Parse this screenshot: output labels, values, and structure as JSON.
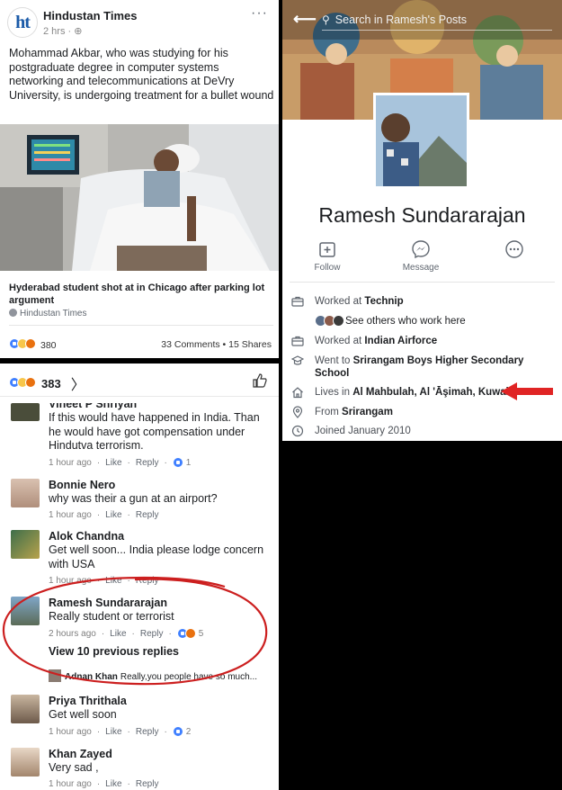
{
  "post": {
    "publisher": "Hindustan Times",
    "logo_text": "ht",
    "time": "2 hrs · ",
    "more": "···",
    "text": "Mohammad Akbar, who was studying for his postgraduate degree in computer systems networking and telecommunications at DeVry University, is undergoing treatment for a bullet wound",
    "link_title": "Hyderabad student shot at in Chicago after parking lot argument",
    "link_source": "Hindustan Times",
    "reaction_count": "380",
    "stats": "33 Comments • 15 Shares"
  },
  "comments_panel": {
    "reaction_count": "383",
    "chevron": "〉",
    "comments": [
      {
        "name": "Vineet P Shriyan",
        "text": "If this would have happened in India. Than he would have got compensation under Hindutva terrorism.",
        "time": "1 hour ago",
        "like": "Like",
        "reply": "Reply",
        "count": "1"
      },
      {
        "name": "Bonnie Nero",
        "text": "why  was their a gun at an airport?",
        "time": "1 hour ago",
        "like": "Like",
        "reply": "Reply"
      },
      {
        "name": "Alok Chandna",
        "text": "Get well soon... India please lodge concern with USA",
        "time": "1 hour ago",
        "like": "Like",
        "reply": "Reply"
      },
      {
        "name": "Ramesh Sundararajan",
        "text": "Really student or terrorist",
        "time": "2 hours ago",
        "like": "Like",
        "reply": "Reply",
        "count": "5"
      },
      {
        "name": "Priya Thrithala",
        "text": "Get well  soon",
        "time": "1 hour ago",
        "like": "Like",
        "reply": "Reply",
        "count": "2"
      },
      {
        "name": "Khan Zayed",
        "text": "Very sad ,",
        "time": "1 hour ago",
        "like": "Like",
        "reply": "Reply"
      }
    ],
    "view_replies": "View 10 previous replies",
    "reply": {
      "name": "Adnan Khan",
      "text": "Really,you people have so much..."
    }
  },
  "profile": {
    "search_placeholder": "Search in Ramesh's Posts",
    "name": "Ramesh Sundararajan",
    "actions": [
      "Follow",
      "Message"
    ],
    "info": {
      "worked1_prefix": "Worked at ",
      "worked1_place": "Technip",
      "see_others": "See others who work here",
      "worked2_prefix": "Worked at ",
      "worked2_place": "Indian Airforce",
      "went_prefix": "Went to ",
      "went_place": "Srirangam Boys Higher Secondary School",
      "lives_prefix": "Lives in ",
      "lives_place": "Al Mahbulah, Al 'Āşimah, Kuwait",
      "from_prefix": "From ",
      "from_place": "Srirangam",
      "joined": "Joined January 2010"
    }
  },
  "colors": {
    "facebook_blue": "#4080ff",
    "annotation_red": "#cc1f1f",
    "arrow_red": "#e02424"
  }
}
